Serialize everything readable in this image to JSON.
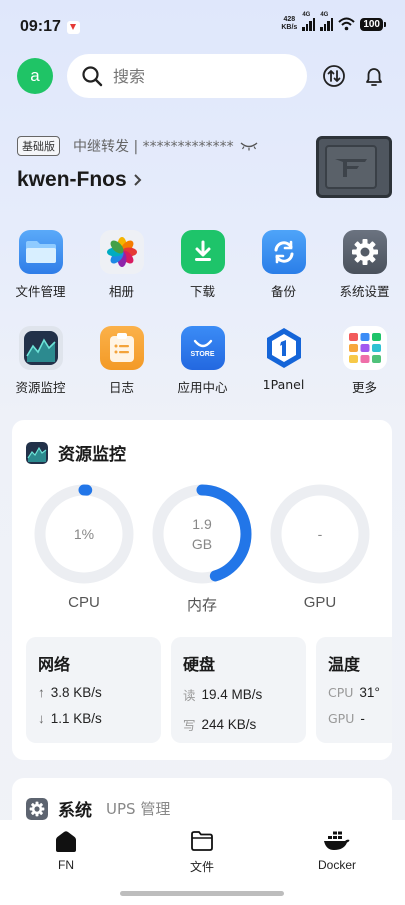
{
  "status_bar": {
    "time": "09:17",
    "net_speed": "428",
    "net_unit": "KB/s",
    "sig1": "4G",
    "sig2": "4G",
    "battery": "100"
  },
  "header": {
    "avatar_letter": "a",
    "search_placeholder": "搜索"
  },
  "device": {
    "plan": "基础版",
    "relay": "中继转发 | *************",
    "name": "kwen-Fnos"
  },
  "apps_row1": [
    {
      "label": "文件管理",
      "icon": "folder-icon",
      "color": "#3a8ef6"
    },
    {
      "label": "相册",
      "icon": "photos-icon",
      "color": "#f0f0f4"
    },
    {
      "label": "下载",
      "icon": "download-icon",
      "color": "#1ec46a"
    },
    {
      "label": "备份",
      "icon": "backup-icon",
      "color": "#2f8ef0"
    },
    {
      "label": "系统设置",
      "icon": "settings-icon",
      "color": "#5d6470"
    }
  ],
  "apps_row2": [
    {
      "label": "资源监控",
      "icon": "monitor-icon",
      "color": "#2b3b52"
    },
    {
      "label": "日志",
      "icon": "log-icon",
      "color": "#f7a73c"
    },
    {
      "label": "应用中心",
      "icon": "store-icon",
      "color": "#2f7df3",
      "text": "STORE"
    },
    {
      "label": "1Panel",
      "icon": "1panel-icon",
      "color": "#1565d8"
    },
    {
      "label": "更多",
      "icon": "more-icon",
      "color": "#ffffff"
    }
  ],
  "monitor": {
    "title": "资源监控",
    "cpu": {
      "label": "CPU",
      "value": "1%",
      "fraction": 0.01
    },
    "mem": {
      "label": "内存",
      "value": "1.9",
      "unit": "GB",
      "fraction": 0.45
    },
    "gpu": {
      "label": "GPU",
      "value": "-",
      "fraction": 0
    },
    "network": {
      "title": "网络",
      "up": "3.8 KB/s",
      "down": "1.1 KB/s"
    },
    "disk": {
      "title": "硬盘",
      "read_label": "读",
      "read": "19.4 MB/s",
      "write_label": "写",
      "write": "244 KB/s"
    },
    "temp": {
      "title": "温度",
      "cpu_label": "CPU",
      "cpu": "31°",
      "gpu_label": "GPU",
      "gpu": "-"
    }
  },
  "system": {
    "title": "系统",
    "ups": "UPS 管理"
  },
  "nav": [
    {
      "label": "FN"
    },
    {
      "label": "文件"
    },
    {
      "label": "Docker"
    }
  ],
  "colors": {
    "accent": "#2276e8",
    "green": "#1fc466",
    "track": "#eceef2"
  }
}
